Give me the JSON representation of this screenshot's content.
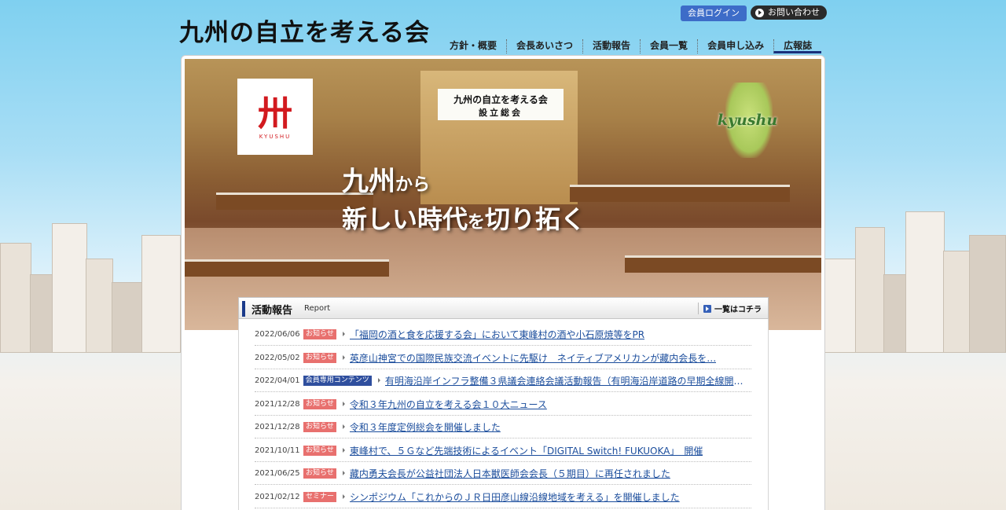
{
  "site": {
    "logo_text": "九州の自立を考える会",
    "login_label": "会員ログイン",
    "contact_label": "お問い合わせ"
  },
  "nav": [
    {
      "label": "方針・概要",
      "active": false
    },
    {
      "label": "会長あいさつ",
      "active": false
    },
    {
      "label": "活動報告",
      "active": false
    },
    {
      "label": "会員一覧",
      "active": false
    },
    {
      "label": "会員申し込み",
      "active": false
    },
    {
      "label": "広報誌",
      "active": true
    }
  ],
  "hero": {
    "banner_line1": "九州の自立を考える会",
    "banner_line2": "設立総会",
    "emblem_sub": "KYUSHU",
    "kyushu_label": "kyushu",
    "catch_line1_main": "九州",
    "catch_line1_small": "から",
    "catch_line2_a": "新しい時代",
    "catch_line2_small": "を",
    "catch_line2_b": "切り拓く"
  },
  "report": {
    "title": "活動報告",
    "title_en": "Report",
    "more_label": "一覧はコチラ",
    "items": [
      {
        "date": "2022/06/06",
        "tag": "お知らせ",
        "tag_color": "#e8706e",
        "text": "「福岡の酒と食を応援する会」において東峰村の酒や小石原焼等をPR"
      },
      {
        "date": "2022/05/02",
        "tag": "お知らせ",
        "tag_color": "#e8706e",
        "text": "英彦山神宮での国際民族交流イベントに先駆け　ネイティブアメリカンが藏内会長を…"
      },
      {
        "date": "2022/04/01",
        "tag": "会員専用コンテンツ",
        "tag_color": "#2f4f9e",
        "text": "有明海沿岸インフラ整備３県議会連絡会議活動報告（有明海沿岸道路の早期全線開通…"
      },
      {
        "date": "2021/12/28",
        "tag": "お知らせ",
        "tag_color": "#e8706e",
        "text": "令和３年九州の自立を考える会１０大ニュース"
      },
      {
        "date": "2021/12/28",
        "tag": "お知らせ",
        "tag_color": "#e8706e",
        "text": "令和３年度定例総会を開催しました"
      },
      {
        "date": "2021/10/11",
        "tag": "お知らせ",
        "tag_color": "#e8706e",
        "text": "東峰村で、５Ｇなど先端技術によるイベント「DIGITAL Switch! FUKUOKA」　開催"
      },
      {
        "date": "2021/06/25",
        "tag": "お知らせ",
        "tag_color": "#e8706e",
        "text": "藏内勇夫会長が公益社団法人日本獣医師会会長（５期目）に再任されました"
      },
      {
        "date": "2021/02/12",
        "tag": "セミナー",
        "tag_color": "#e8706e",
        "text": "シンポジウム「これからのＪＲ日田彦山線沿線地域を考える」を開催しました"
      }
    ]
  }
}
